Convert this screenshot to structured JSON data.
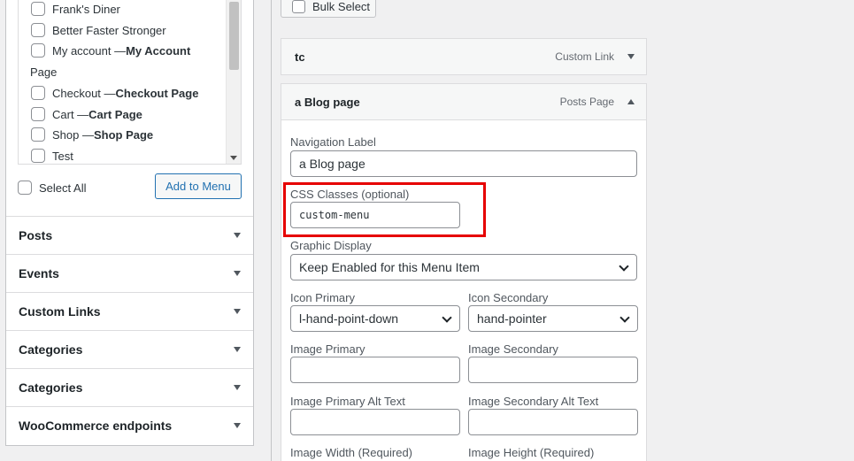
{
  "left_panel": {
    "pages": [
      {
        "label": "Frank's Diner",
        "bold": ""
      },
      {
        "label": "Better Faster Stronger",
        "bold": ""
      },
      {
        "label": "My account — ",
        "bold": "My Account"
      },
      {
        "label": "Checkout — ",
        "bold": "Checkout Page"
      },
      {
        "label": "Cart — ",
        "bold": "Cart Page"
      },
      {
        "label": "Shop — ",
        "bold": "Shop Page"
      },
      {
        "label": "Test",
        "bold": ""
      }
    ],
    "wrap_text": "Page",
    "select_all": "Select All",
    "add_to_menu": "Add to Menu",
    "sections": [
      "Posts",
      "Events",
      "Custom Links",
      "Categories",
      "Categories",
      "WooCommerce endpoints"
    ]
  },
  "right_panel": {
    "bulk_select": "Bulk Select",
    "items": [
      {
        "title": "tc",
        "type": "Custom Link"
      },
      {
        "title": "a Blog page",
        "type": "Posts Page"
      }
    ],
    "fields": {
      "nav_label": {
        "label": "Navigation Label",
        "value": "a Blog page"
      },
      "css_classes": {
        "label": "CSS Classes (optional)",
        "value": "custom-menu"
      },
      "graphic_display": {
        "label": "Graphic Display",
        "value": "Keep Enabled for this Menu Item"
      },
      "icon_primary": {
        "label": "Icon Primary",
        "value": "l-hand-point-down"
      },
      "icon_secondary": {
        "label": "Icon Secondary",
        "value": "hand-pointer"
      },
      "image_primary": {
        "label": "Image Primary",
        "value": ""
      },
      "image_secondary": {
        "label": "Image Secondary",
        "value": ""
      },
      "image_primary_alt": {
        "label": "Image Primary Alt Text",
        "value": ""
      },
      "image_secondary_alt": {
        "label": "Image Secondary Alt Text",
        "value": ""
      },
      "image_width": {
        "label": "Image Width (Required)"
      },
      "image_height": {
        "label": "Image Height (Required)"
      }
    }
  },
  "colors": {
    "accent": "#2271b1",
    "highlight": "#e60000"
  }
}
